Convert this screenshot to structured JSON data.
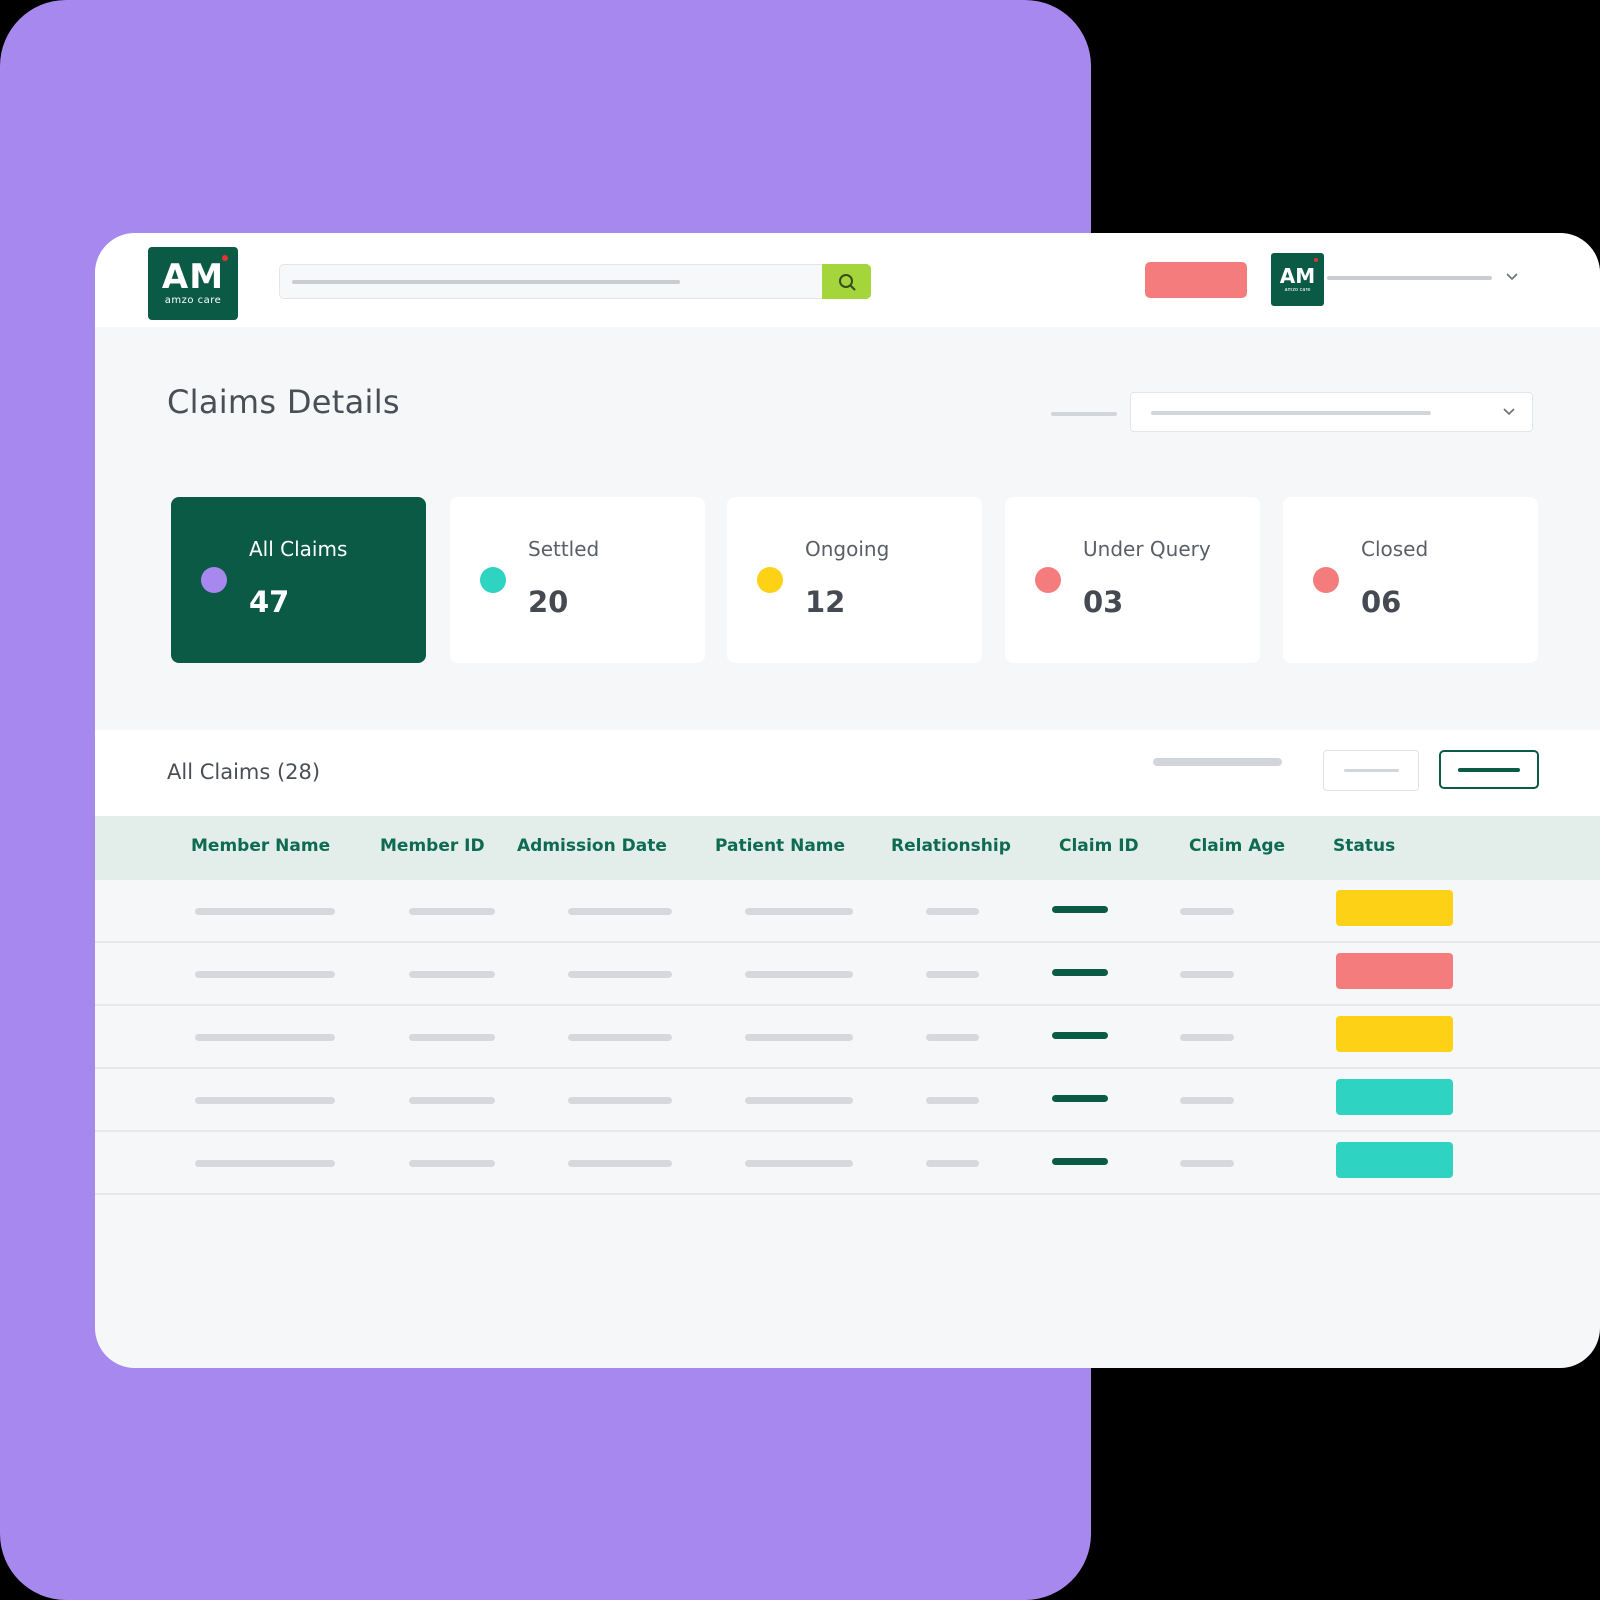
{
  "brand": {
    "logo_mark": "AM",
    "logo_sub": "amzo care",
    "color": "#0b5a45"
  },
  "colors": {
    "background_card": "#a688ee",
    "accent_search": "#a4d63b",
    "action_button": "#f47c7c"
  },
  "search": {
    "icon": "search-icon"
  },
  "page": {
    "title": "Claims Details"
  },
  "stats": [
    {
      "label": "All Claims",
      "value": "47",
      "dot_color": "#a688ee",
      "active": true
    },
    {
      "label": "Settled",
      "value": "20",
      "dot_color": "#2ed3c1",
      "active": false
    },
    {
      "label": "Ongoing",
      "value": "12",
      "dot_color": "#fcd116",
      "active": false
    },
    {
      "label": "Under Query",
      "value": "03",
      "dot_color": "#f47c7c",
      "active": false
    },
    {
      "label": "Closed",
      "value": "06",
      "dot_color": "#f47c7c",
      "active": false
    }
  ],
  "claims_list": {
    "title": "All Claims (28)",
    "columns": [
      "Member Name",
      "Member ID",
      "Admission Date",
      "Patient Name",
      "Relationship",
      "Claim ID",
      "Claim Age",
      "Status"
    ],
    "row_status_colors": [
      "#fcd116",
      "#f47c7c",
      "#fcd116",
      "#2ed3c1",
      "#2ed3c1"
    ]
  }
}
